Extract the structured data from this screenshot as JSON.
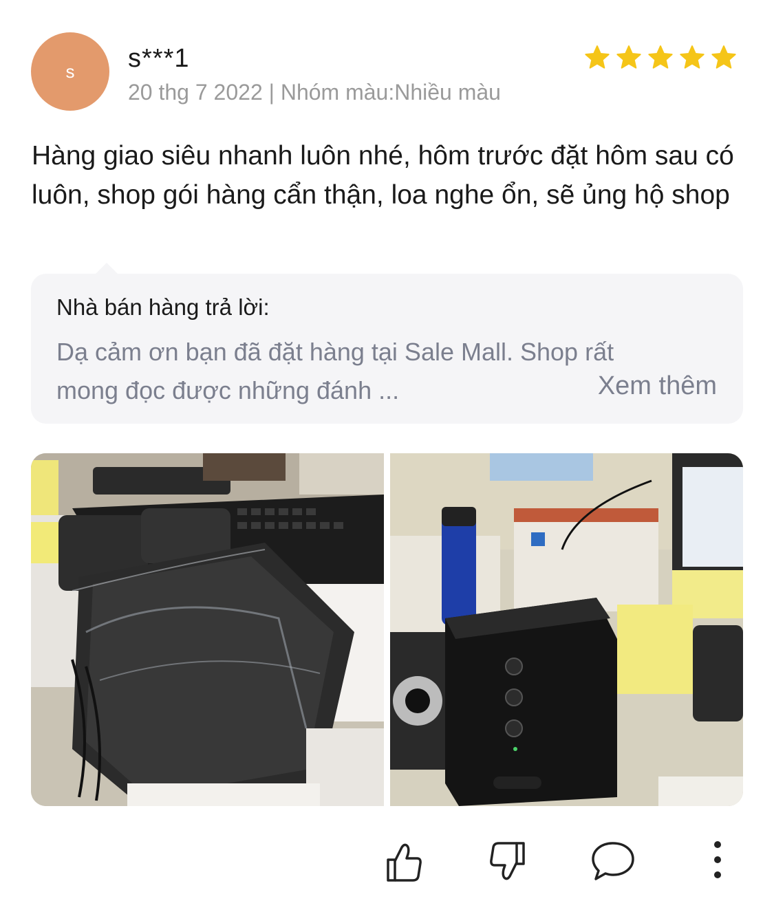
{
  "review": {
    "avatar_initial": "s",
    "avatar_color": "#e39a6c",
    "username": "s***1",
    "meta": "20 thg 7 2022 | Nhóm màu:Nhiều màu",
    "rating": 5,
    "star_color": "#f5c518",
    "text": "Hàng giao siêu nhanh luôn nhé, hôm trước đặt hôm sau có luôn, shop gói hàng cẩn thận, loa nghe ổn, sẽ ủng hộ shop"
  },
  "seller_reply": {
    "title": "Nhà bán hàng trả lời:",
    "body_line1": "Dạ cảm ơn bạn đã đặt hàng tại Sale Mall. Shop rất",
    "body_line2": "mong đọc được những đánh ...",
    "see_more": "Xem thêm"
  },
  "photos": [
    {
      "subject": "wrapped-speakers-on-desk"
    },
    {
      "subject": "black-speaker-on-desk"
    }
  ],
  "actions": {
    "like_icon": "thumbs-up-icon",
    "dislike_icon": "thumbs-down-icon",
    "comment_icon": "comment-icon",
    "more_icon": "more-vertical-icon"
  }
}
